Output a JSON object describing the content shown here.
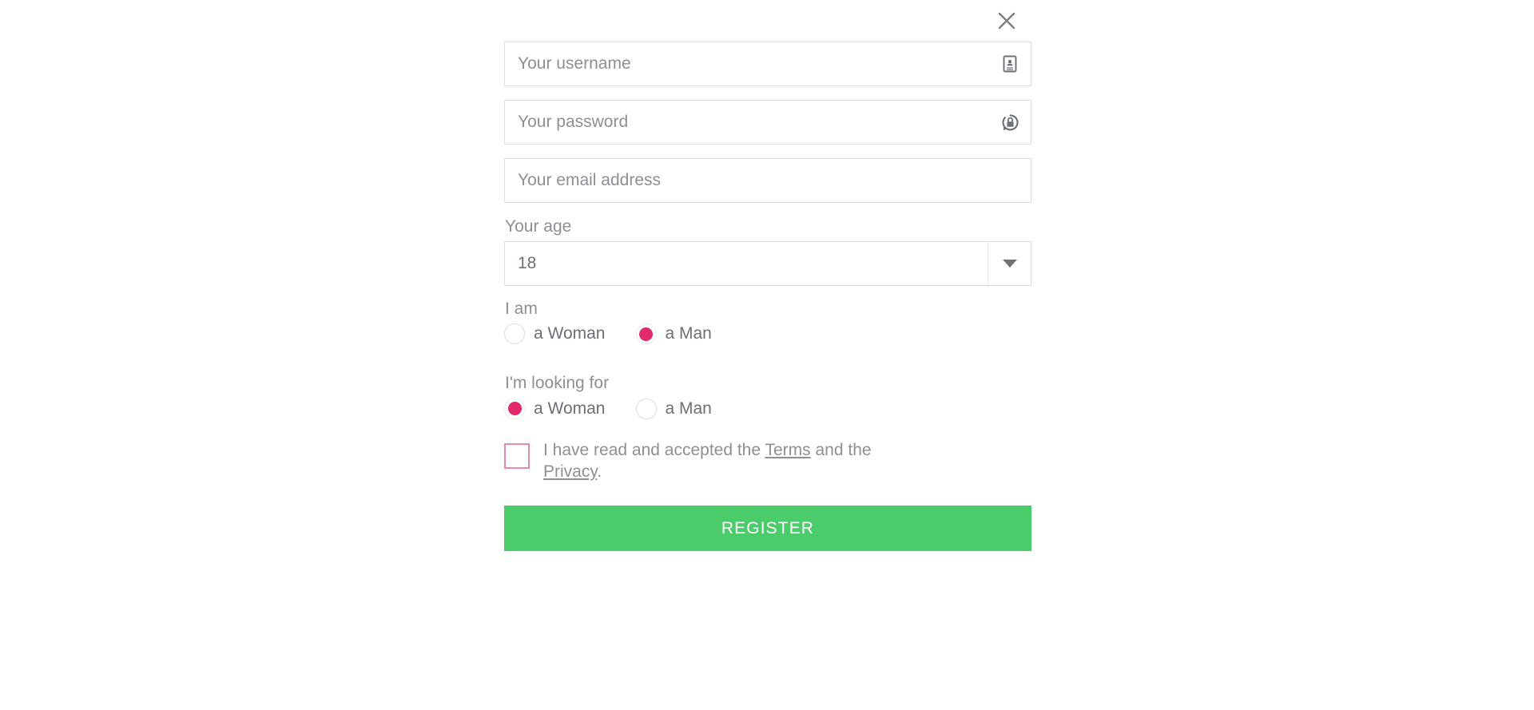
{
  "dialog": {
    "close_icon": "close-icon"
  },
  "fields": {
    "username": {
      "placeholder": "Your username",
      "value": "",
      "icon": "id-card-icon"
    },
    "password": {
      "placeholder": "Your password",
      "value": "",
      "icon": "password-lock-reset-icon"
    },
    "email": {
      "placeholder": "Your email address",
      "value": "",
      "icon": ""
    }
  },
  "age": {
    "label": "Your age",
    "selected": "18",
    "dropdown_icon": "chevron-down-icon"
  },
  "i_am": {
    "label": "I am",
    "options": [
      {
        "label": "a Woman",
        "selected": false
      },
      {
        "label": "a Man",
        "selected": true
      }
    ]
  },
  "looking_for": {
    "label": "I'm looking for",
    "options": [
      {
        "label": "a Woman",
        "selected": true
      },
      {
        "label": "a Man",
        "selected": false
      }
    ]
  },
  "terms": {
    "checked": false,
    "text_before": "I have read and accepted the ",
    "link_terms": "Terms",
    "text_middle": " and the ",
    "link_privacy": "Privacy",
    "text_after": "."
  },
  "submit": {
    "label": "REGISTER"
  },
  "colors": {
    "accent_pink": "#e02a6d",
    "checkbox_pink": "#e58aaa",
    "submit_green": "#4ccb6b",
    "text_gray": "#8c9096",
    "input_text": "#6b6f76",
    "border_gray": "#e0e0e0",
    "icon_gray": "#6b6f76",
    "background": "#ffffff"
  }
}
